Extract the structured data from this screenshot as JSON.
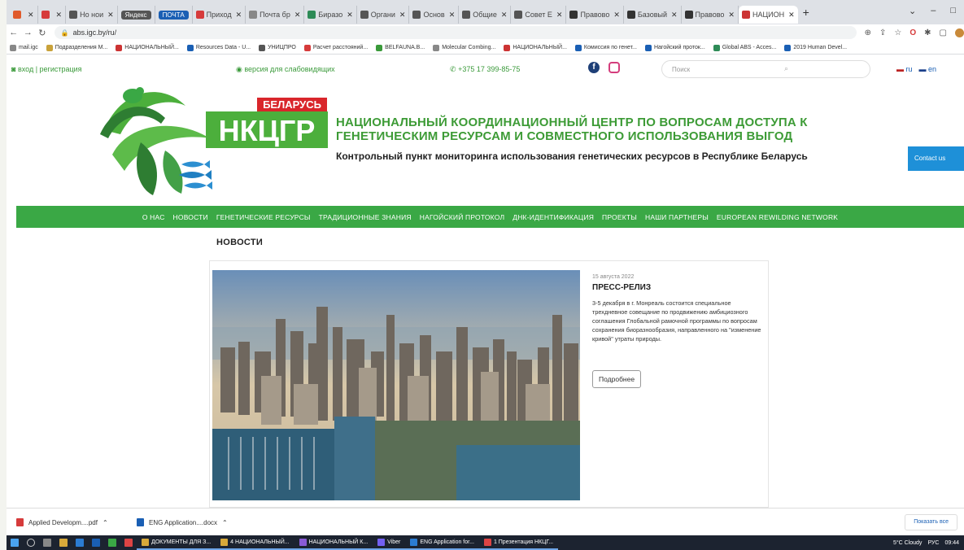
{
  "browser": {
    "tabs": [
      {
        "label": "",
        "color": "#e05a2b"
      },
      {
        "label": "",
        "color": "#d63b3b"
      },
      {
        "label": "Но нои",
        "color": "#555"
      },
      {
        "label": "Яндекс",
        "badge": true
      },
      {
        "label": "ПОЧТА",
        "badge": true,
        "blue": true
      },
      {
        "label": "Приход",
        "color": "#d63b3b"
      },
      {
        "label": "Почта бр",
        "color": "#888"
      },
      {
        "label": "Биразо",
        "color": "#2e8b57"
      },
      {
        "label": "Органи",
        "color": "#555"
      },
      {
        "label": "Основ",
        "color": "#555"
      },
      {
        "label": "Общие",
        "color": "#555"
      },
      {
        "label": "Совет Е",
        "color": "#555"
      },
      {
        "label": "Правово",
        "color": "#333"
      },
      {
        "label": "Базовый",
        "color": "#333"
      },
      {
        "label": "Правово",
        "color": "#333"
      },
      {
        "label": "НАЦИОН",
        "color": "#c33",
        "active": true
      }
    ],
    "url": "abs.igc.by/ru/",
    "bookmarks": [
      {
        "label": "mail.igc",
        "color": "#888"
      },
      {
        "label": "Подразделения М...",
        "color": "#c9a23a"
      },
      {
        "label": "НАЦИОНАЛЬНЫЙ...",
        "color": "#c33"
      },
      {
        "label": "Resources Data - U...",
        "color": "#1a5fb4"
      },
      {
        "label": "УНИЦПРО",
        "color": "#555"
      },
      {
        "label": "Расчет расстояний...",
        "color": "#d63b3b"
      },
      {
        "label": "BELFAUNA.B...",
        "color": "#3a9a3a"
      },
      {
        "label": "Molecular Combing...",
        "color": "#888"
      },
      {
        "label": "НАЦИОНАЛЬНЫЙ...",
        "color": "#c33"
      },
      {
        "label": "Комиссия по генет...",
        "color": "#1a5fb4"
      },
      {
        "label": "Нагойский проток...",
        "color": "#1a5fb4"
      },
      {
        "label": "Global ABS - Acces...",
        "color": "#2e8b57"
      },
      {
        "label": "2019 Human Devel...",
        "color": "#1a5fb4"
      }
    ]
  },
  "site": {
    "login": "вход | регистрация",
    "vision": "версия для слабовидящих",
    "phone": "+375 17 399-85-75",
    "search_placeholder": "Поиск",
    "lang_ru": "ru",
    "lang_en": "en",
    "logo_country": "БЕЛАРУСЬ",
    "logo_abbr": "НКЦГР",
    "title_line1": "НАЦИОНАЛЬНЫЙ КООРДИНАЦИОННЫЙ ЦЕНТР ПО ВОПРОСАМ ДОСТУПА К",
    "title_line2": "ГЕНЕТИЧЕСКИМ РЕСУРСАМ И СОВМЕСТНОГО ИСПОЛЬЗОВАНИЯ ВЫГОД",
    "subtitle": "Контрольный пункт мониторинга использования генетических ресурсов в Республике Беларусь",
    "contact": "Contact us",
    "menu": [
      "О НАС",
      "НОВОСТИ",
      "ГЕНЕТИЧЕСКИЕ РЕСУРСЫ",
      "ТРАДИЦИОННЫЕ ЗНАНИЯ",
      "НАГОЙСКИЙ ПРОТОКОЛ",
      "ДНК-ИДЕНТИФИКАЦИЯ",
      "ПРОЕКТЫ",
      "НАШИ ПАРТНЕРЫ",
      "EUROPEAN REWILDING NETWORK"
    ],
    "news_heading": "НОВОСТИ",
    "news": {
      "date": "15 августа 2022",
      "title": "ПРЕСС-РЕЛИЗ",
      "text": "3-5 декабря в г. Монреаль состоится специальное трехдневное совещание по продвижению амбициозного соглашения Глобальной рамочной программы по вопросам сохранения биоразнообразия, направленного на \"изменение кривой\" утраты природы.",
      "button": "Подробнее"
    }
  },
  "downloads": {
    "items": [
      "Applied Developm....pdf",
      "ENG Application....docx"
    ],
    "show_all": "Показать все"
  },
  "taskbar": {
    "apps": [
      "ДОКУМЕНТЫ ДЛЯ З...",
      "4 НАЦИОНАЛЬНЫЙ...",
      "НАЦИОНАЛЬНЫЙ К...",
      "Viber",
      "ENG Application for...",
      "1 Презентация НКЦГ..."
    ],
    "weather": "5°C Cloudy",
    "lang": "РУС",
    "time": "09:44"
  }
}
